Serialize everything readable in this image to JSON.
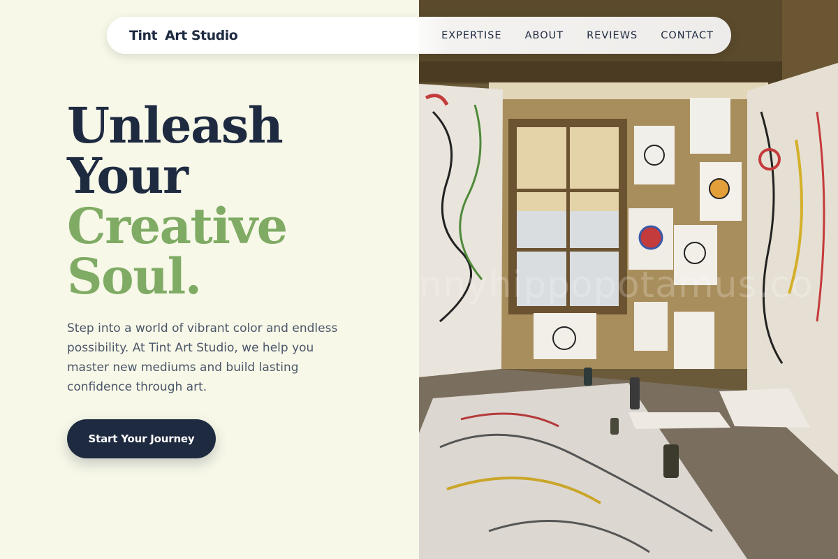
{
  "nav": {
    "brand_word1": "Tint",
    "brand_word2": "Art Studio",
    "links": [
      "EXPERTISE",
      "ABOUT",
      "REVIEWS",
      "CONTACT"
    ]
  },
  "hero": {
    "headline_line1": "Unleash",
    "headline_line2": "Your",
    "headline_line3": "Creative",
    "headline_line4": "Soul.",
    "lead": "Step into a world of vibrant color and endless possibility. At Tint Art Studio, we help you master new mediums and build lasting confidence through art.",
    "cta_label": "Start Your Journey"
  },
  "photo": {
    "description_icon": "art-studio-photo",
    "watermark": "nnyhippopotamus.co"
  },
  "colors": {
    "background": "#f7f8e8",
    "navy": "#1e2a40",
    "green": "#7fab64",
    "body_text": "#4b5669"
  }
}
